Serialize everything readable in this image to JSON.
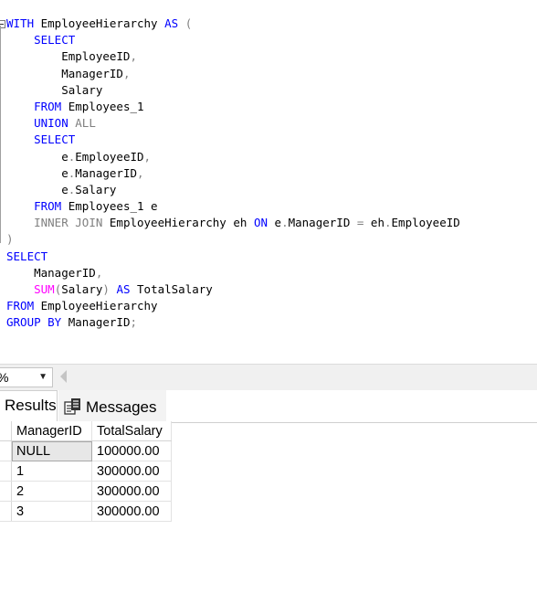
{
  "editor": {
    "lines": [
      [
        {
          "t": "WITH",
          "c": "kw"
        },
        {
          "t": " EmployeeHierarchy ",
          "c": ""
        },
        {
          "t": "AS",
          "c": "kw"
        },
        {
          "t": " (",
          "c": "gr"
        }
      ],
      [
        {
          "t": "    ",
          "c": ""
        },
        {
          "t": "SELECT",
          "c": "kw"
        }
      ],
      [
        {
          "t": "        EmployeeID",
          "c": ""
        },
        {
          "t": ",",
          "c": "gr"
        }
      ],
      [
        {
          "t": "        ManagerID",
          "c": ""
        },
        {
          "t": ",",
          "c": "gr"
        }
      ],
      [
        {
          "t": "        Salary",
          "c": ""
        }
      ],
      [
        {
          "t": "    ",
          "c": ""
        },
        {
          "t": "FROM",
          "c": "kw"
        },
        {
          "t": " Employees_1",
          "c": ""
        }
      ],
      [
        {
          "t": "    ",
          "c": ""
        },
        {
          "t": "UNION",
          "c": "kw"
        },
        {
          "t": " ALL",
          "c": "gr"
        }
      ],
      [
        {
          "t": "    ",
          "c": ""
        },
        {
          "t": "SELECT",
          "c": "kw"
        }
      ],
      [
        {
          "t": "        e",
          "c": ""
        },
        {
          "t": ".",
          "c": "gr"
        },
        {
          "t": "EmployeeID",
          "c": ""
        },
        {
          "t": ",",
          "c": "gr"
        }
      ],
      [
        {
          "t": "        e",
          "c": ""
        },
        {
          "t": ".",
          "c": "gr"
        },
        {
          "t": "ManagerID",
          "c": ""
        },
        {
          "t": ",",
          "c": "gr"
        }
      ],
      [
        {
          "t": "        e",
          "c": ""
        },
        {
          "t": ".",
          "c": "gr"
        },
        {
          "t": "Salary",
          "c": ""
        }
      ],
      [
        {
          "t": "    ",
          "c": ""
        },
        {
          "t": "FROM",
          "c": "kw"
        },
        {
          "t": " Employees_1 e",
          "c": ""
        }
      ],
      [
        {
          "t": "    ",
          "c": ""
        },
        {
          "t": "INNER JOIN",
          "c": "gr"
        },
        {
          "t": " EmployeeHierarchy eh ",
          "c": ""
        },
        {
          "t": "ON",
          "c": "kw"
        },
        {
          "t": " e",
          "c": ""
        },
        {
          "t": ".",
          "c": "gr"
        },
        {
          "t": "ManagerID ",
          "c": ""
        },
        {
          "t": "=",
          "c": "gr"
        },
        {
          "t": " eh",
          "c": ""
        },
        {
          "t": ".",
          "c": "gr"
        },
        {
          "t": "EmployeeID",
          "c": ""
        }
      ],
      [
        {
          "t": ")",
          "c": "gr"
        }
      ],
      [
        {
          "t": "SELECT",
          "c": "kw"
        }
      ],
      [
        {
          "t": "    ManagerID",
          "c": ""
        },
        {
          "t": ",",
          "c": "gr"
        }
      ],
      [
        {
          "t": "    ",
          "c": ""
        },
        {
          "t": "SUM",
          "c": "fn"
        },
        {
          "t": "(",
          "c": "gr"
        },
        {
          "t": "Salary",
          "c": ""
        },
        {
          "t": ")",
          "c": "gr"
        },
        {
          "t": " ",
          "c": ""
        },
        {
          "t": "AS",
          "c": "kw"
        },
        {
          "t": " TotalSalary",
          "c": ""
        }
      ],
      [
        {
          "t": "FROM",
          "c": "kw"
        },
        {
          "t": " EmployeeHierarchy",
          "c": ""
        }
      ],
      [
        {
          "t": "GROUP BY",
          "c": "kw"
        },
        {
          "t": " ManagerID",
          "c": ""
        },
        {
          "t": ";",
          "c": "gr"
        }
      ]
    ]
  },
  "zoom": {
    "value": "%"
  },
  "tabs": {
    "results": "Results",
    "messages": "Messages"
  },
  "grid": {
    "columns": [
      "ManagerID",
      "TotalSalary"
    ],
    "rows": [
      [
        "NULL",
        "100000.00"
      ],
      [
        "1",
        "300000.00"
      ],
      [
        "2",
        "300000.00"
      ],
      [
        "3",
        "300000.00"
      ]
    ]
  },
  "colors": {
    "keyword": "#0000ff",
    "operator": "#808080",
    "function": "#ff00ff"
  }
}
